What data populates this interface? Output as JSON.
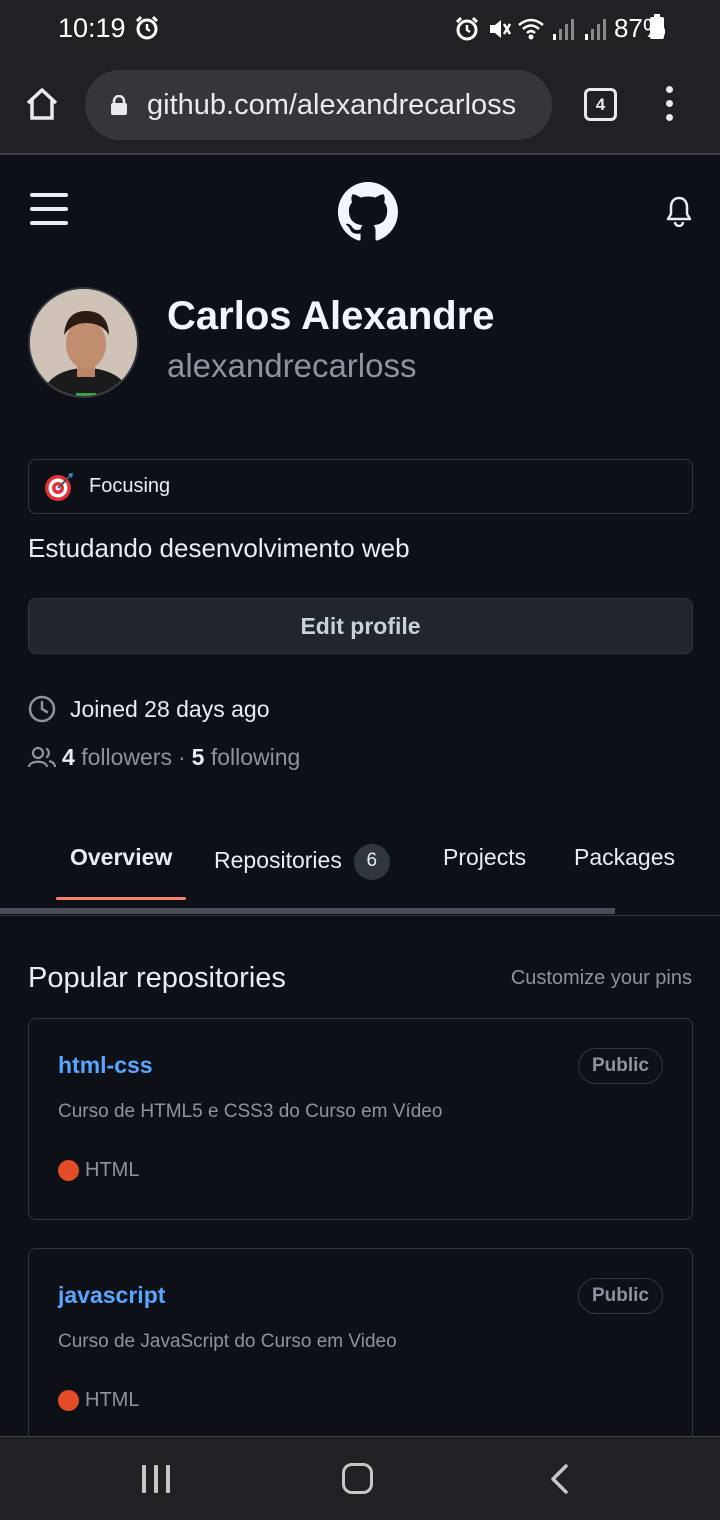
{
  "status_bar": {
    "time": "10:19",
    "battery": "87%",
    "icons": [
      "alarm-icon",
      "alarm-icon",
      "mute-icon",
      "wifi-icon",
      "signal-icon",
      "signal-icon",
      "battery-icon"
    ]
  },
  "browser": {
    "url": "github.com/alexandrecarloss",
    "tab_count": "4"
  },
  "profile": {
    "name": "Carlos Alexandre",
    "login": "alexandrecarloss",
    "status": "Focusing",
    "bio": "Estudando desenvolvimento web",
    "edit_button": "Edit profile",
    "joined": "Joined 28 days ago",
    "followers_count": "4",
    "followers_label": "followers",
    "separator": "·",
    "following_count": "5",
    "following_label": "following"
  },
  "tabs": [
    {
      "label": "Overview",
      "active": true
    },
    {
      "label": "Repositories",
      "counter": "6"
    },
    {
      "label": "Projects"
    },
    {
      "label": "Packages"
    }
  ],
  "popular": {
    "title": "Popular repositories",
    "customize": "Customize your pins",
    "repos": [
      {
        "name": "html-css",
        "visibility": "Public",
        "description": "Curso de HTML5 e CSS3 do Curso em Vídeo",
        "language": "HTML"
      },
      {
        "name": "javascript",
        "visibility": "Public",
        "description": "Curso de JavaScript do Curso em Video",
        "language": "HTML"
      }
    ]
  },
  "colors": {
    "background": "#0d1117",
    "link": "#58a6ff",
    "tab_underline": "#f78166",
    "html_language": "#e34c26"
  }
}
